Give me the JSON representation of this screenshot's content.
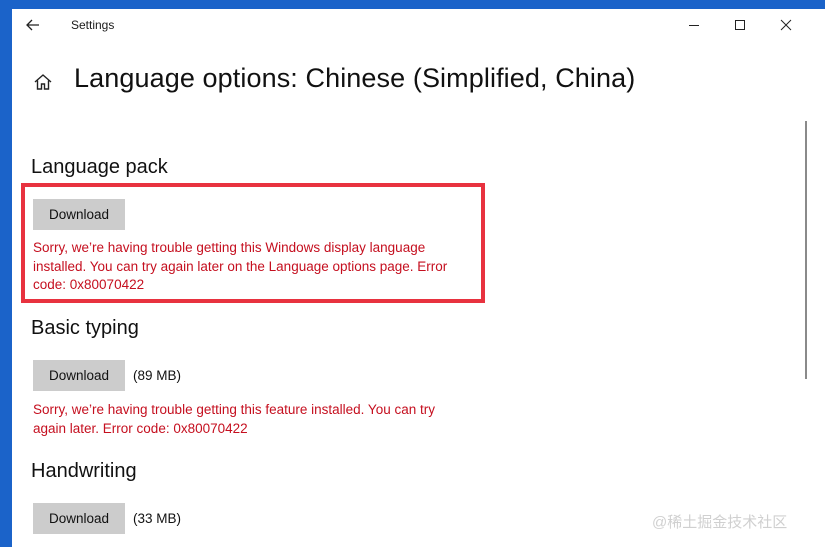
{
  "window": {
    "title": "Settings",
    "controls": {
      "minimize": "minimize-icon",
      "maximize": "maximize-icon",
      "close": "close-icon"
    }
  },
  "page": {
    "title": "Language options: Chinese (Simplified, China)"
  },
  "sections": {
    "language_pack": {
      "title": "Language pack",
      "button_label": "Download",
      "error": "Sorry, we’re having trouble getting this Windows display language installed. You can try again later on the Language options page. Error code: 0x80070422"
    },
    "basic_typing": {
      "title": "Basic typing",
      "button_label": "Download",
      "size": "(89 MB)",
      "error": "Sorry, we’re having trouble getting this feature installed. You can try again later. Error code: 0x80070422"
    },
    "handwriting": {
      "title": "Handwriting",
      "button_label": "Download",
      "size": "(33 MB)"
    }
  },
  "footer_watermark": "@稀土掘金技术社区",
  "colors": {
    "error": "#c50f1f",
    "highlight": "#e8323f",
    "button": "#cccccc",
    "desktop": "#1b63c9"
  }
}
